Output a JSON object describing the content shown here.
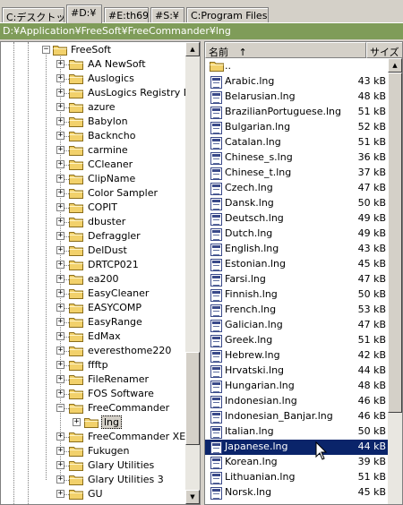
{
  "tabs": [
    "C:デスクトップ",
    "#D:¥",
    "#E:th69",
    "#S:¥",
    "C:Program Files"
  ],
  "path": "D:¥Application¥FreeSoft¥FreeCommander¥lng",
  "tree": {
    "root": "FreeSoft",
    "items": [
      "AA NewSoft",
      "Auslogics",
      "AusLogics Registry D",
      "azure",
      "Babylon",
      "Backncho",
      "carmine",
      "CCleaner",
      "ClipName",
      "Color Sampler",
      "COPIT",
      "dbuster",
      "Defraggler",
      "DelDust",
      "DRTCP021",
      "ea200",
      "EasyCleaner",
      "EASYCOMP",
      "EasyRange",
      "EdMax",
      "everesthome220",
      "ffftp",
      "FileRenamer",
      "FOS Software",
      "FreeCommander"
    ],
    "child": "lng",
    "after": [
      "FreeCommander XE",
      "Fukugen",
      "Glary Utilities",
      "Glary Utilities 3",
      "GU"
    ]
  },
  "list": {
    "col_name": "名前",
    "sort_indicator": "↑",
    "col_size": "サイズ",
    "parent": "..",
    "files": [
      {
        "name": "Arabic.lng",
        "size": "43 kB"
      },
      {
        "name": "Belarusian.lng",
        "size": "48 kB"
      },
      {
        "name": "BrazilianPortuguese.lng",
        "size": "51 kB"
      },
      {
        "name": "Bulgarian.lng",
        "size": "52 kB"
      },
      {
        "name": "Catalan.lng",
        "size": "51 kB"
      },
      {
        "name": "Chinese_s.lng",
        "size": "36 kB"
      },
      {
        "name": "Chinese_t.lng",
        "size": "37 kB"
      },
      {
        "name": "Czech.lng",
        "size": "47 kB"
      },
      {
        "name": "Dansk.lng",
        "size": "50 kB"
      },
      {
        "name": "Deutsch.lng",
        "size": "49 kB"
      },
      {
        "name": "Dutch.lng",
        "size": "49 kB"
      },
      {
        "name": "English.lng",
        "size": "43 kB"
      },
      {
        "name": "Estonian.lng",
        "size": "45 kB"
      },
      {
        "name": "Farsi.lng",
        "size": "47 kB"
      },
      {
        "name": "Finnish.lng",
        "size": "50 kB"
      },
      {
        "name": "French.lng",
        "size": "53 kB"
      },
      {
        "name": "Galician.lng",
        "size": "47 kB"
      },
      {
        "name": "Greek.lng",
        "size": "51 kB"
      },
      {
        "name": "Hebrew.lng",
        "size": "42 kB"
      },
      {
        "name": "Hrvatski.lng",
        "size": "44 kB"
      },
      {
        "name": "Hungarian.lng",
        "size": "48 kB"
      },
      {
        "name": "Indonesian.lng",
        "size": "46 kB"
      },
      {
        "name": "Indonesian_Banjar.lng",
        "size": "46 kB"
      },
      {
        "name": "Italian.lng",
        "size": "50 kB"
      },
      {
        "name": "Japanese.lng",
        "size": "44 kB"
      },
      {
        "name": "Korean.lng",
        "size": "39 kB"
      },
      {
        "name": "Lithuanian.lng",
        "size": "51 kB"
      },
      {
        "name": "Norsk.lng",
        "size": "45 kB"
      }
    ],
    "selected": "Japanese.lng"
  },
  "colors": {
    "path_bg": "#7f9c59",
    "selection": "#0a246a",
    "folder": "#f2d16b"
  }
}
